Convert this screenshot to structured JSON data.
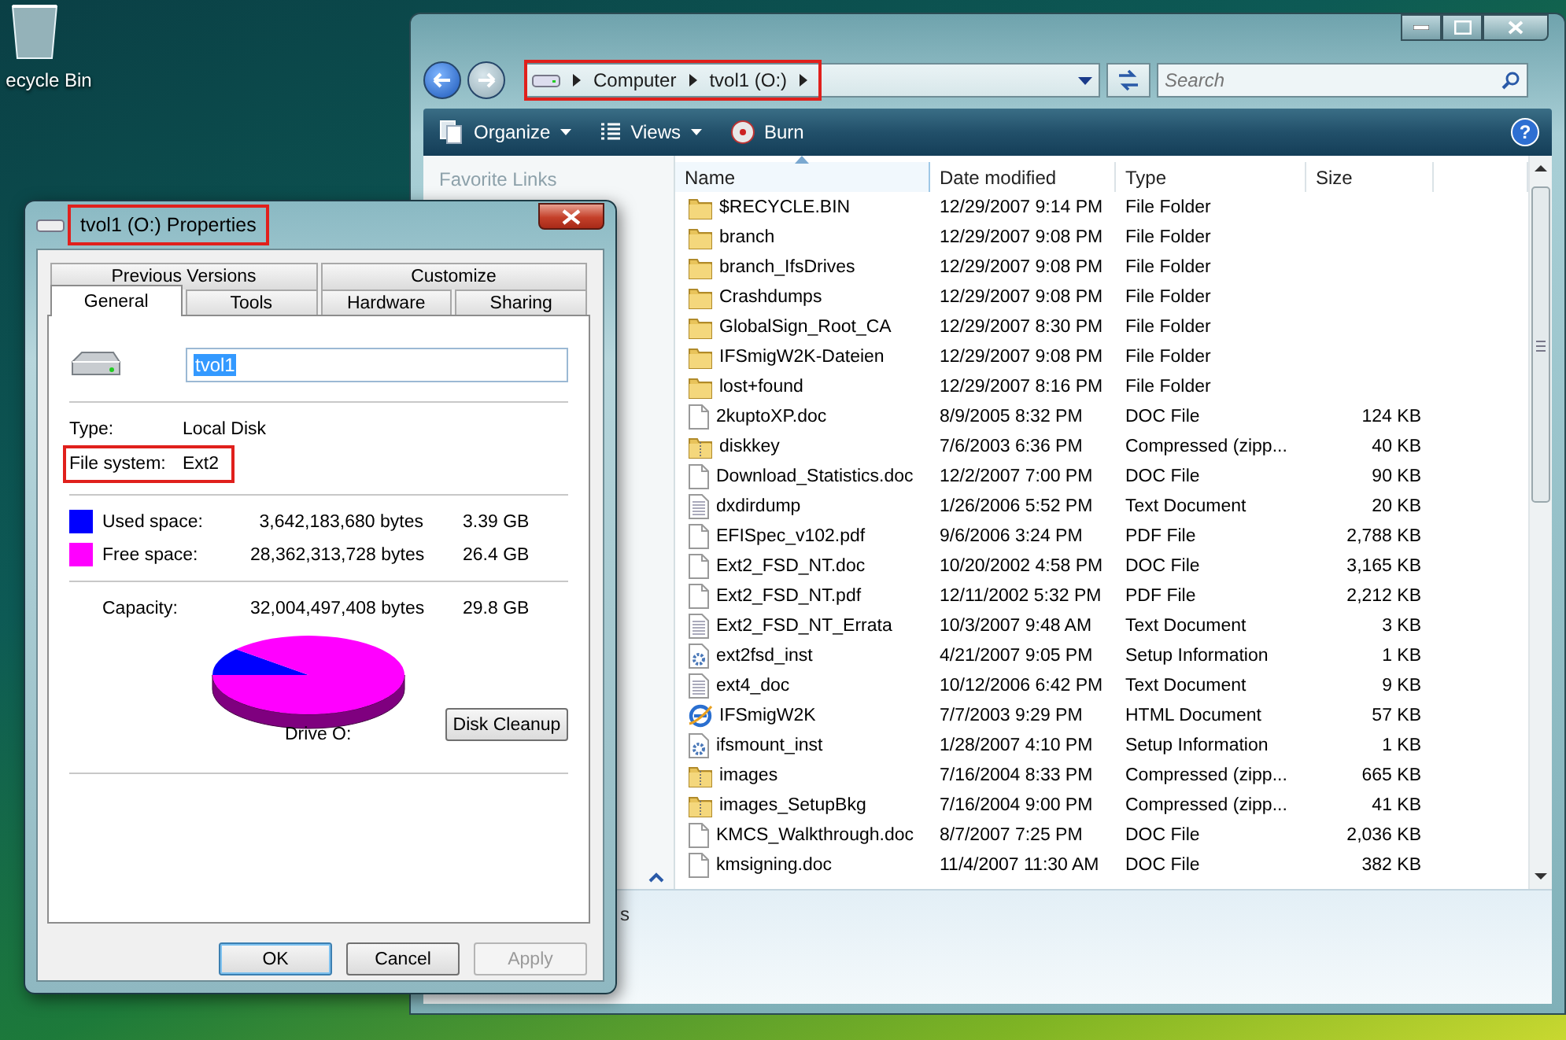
{
  "desktop": {
    "icons": [
      {
        "label": "ecycle Bin"
      }
    ]
  },
  "explorer": {
    "address": {
      "breadcrumbs": [
        "Computer",
        "tvol1 (O:)"
      ],
      "highlighted": true
    },
    "search": {
      "placeholder": "Search"
    },
    "help_button": "?",
    "toolbar": [
      {
        "label": "Organize",
        "kind": "organize",
        "dropdown": true
      },
      {
        "label": "Views",
        "kind": "views",
        "dropdown": true
      },
      {
        "label": "Burn",
        "kind": "burn",
        "dropdown": false
      }
    ],
    "nav_pane": {
      "heading": "Favorite Links",
      "folders_label": "s"
    },
    "columns": [
      {
        "label": "Name",
        "sorted": true
      },
      {
        "label": "Date modified",
        "sorted": false
      },
      {
        "label": "Type",
        "sorted": false
      },
      {
        "label": "Size",
        "sorted": false
      }
    ],
    "rows": [
      {
        "name": "$RECYCLE.BIN",
        "date": "12/29/2007 9:14 PM",
        "type": "File Folder",
        "kind": "folder"
      },
      {
        "name": "branch",
        "date": "12/29/2007 9:08 PM",
        "type": "File Folder",
        "kind": "folder"
      },
      {
        "name": "branch_IfsDrives",
        "date": "12/29/2007 9:08 PM",
        "type": "File Folder",
        "kind": "folder"
      },
      {
        "name": "Crashdumps",
        "date": "12/29/2007 9:08 PM",
        "type": "File Folder",
        "kind": "folder"
      },
      {
        "name": "GlobalSign_Root_CA",
        "date": "12/29/2007 8:30 PM",
        "type": "File Folder",
        "kind": "folder"
      },
      {
        "name": "IFSmigW2K-Dateien",
        "date": "12/29/2007 9:08 PM",
        "type": "File Folder",
        "kind": "folder"
      },
      {
        "name": "lost+found",
        "date": "12/29/2007 8:16 PM",
        "type": "File Folder",
        "kind": "folder"
      },
      {
        "name": "2kuptoXP.doc",
        "date": "8/9/2005 8:32 PM",
        "type": "DOC File",
        "size": "124 KB",
        "kind": "document"
      },
      {
        "name": "diskkey",
        "date": "7/6/2003 6:36 PM",
        "type": "Compressed (zipp...",
        "size": "40 KB",
        "kind": "zip"
      },
      {
        "name": "Download_Statistics.doc",
        "date": "12/2/2007 7:00 PM",
        "type": "DOC File",
        "size": "90 KB",
        "kind": "document"
      },
      {
        "name": "dxdirdump",
        "date": "1/26/2006 5:52 PM",
        "type": "Text Document",
        "size": "20 KB",
        "kind": "text"
      },
      {
        "name": "EFISpec_v102.pdf",
        "date": "9/6/2006 3:24 PM",
        "type": "PDF File",
        "size": "2,788 KB",
        "kind": "document"
      },
      {
        "name": "Ext2_FSD_NT.doc",
        "date": "10/20/2002 4:58 PM",
        "type": "DOC File",
        "size": "3,165 KB",
        "kind": "document"
      },
      {
        "name": "Ext2_FSD_NT.pdf",
        "date": "12/11/2002 5:32 PM",
        "type": "PDF File",
        "size": "2,212 KB",
        "kind": "document"
      },
      {
        "name": "Ext2_FSD_NT_Errata",
        "date": "10/3/2007 9:48 AM",
        "type": "Text Document",
        "size": "3 KB",
        "kind": "text"
      },
      {
        "name": "ext2fsd_inst",
        "date": "4/21/2007 9:05 PM",
        "type": "Setup Information",
        "size": "1 KB",
        "kind": "setup"
      },
      {
        "name": "ext4_doc",
        "date": "10/12/2006 6:42 PM",
        "type": "Text Document",
        "size": "9 KB",
        "kind": "text"
      },
      {
        "name": "IFSmigW2K",
        "date": "7/7/2003 9:29 PM",
        "type": "HTML Document",
        "size": "57 KB",
        "kind": "html"
      },
      {
        "name": "ifsmount_inst",
        "date": "1/28/2007 4:10 PM",
        "type": "Setup Information",
        "size": "1 KB",
        "kind": "setup"
      },
      {
        "name": "images",
        "date": "7/16/2004 8:33 PM",
        "type": "Compressed (zipp...",
        "size": "665 KB",
        "kind": "zip"
      },
      {
        "name": "images_SetupBkg",
        "date": "7/16/2004 9:00 PM",
        "type": "Compressed (zipp...",
        "size": "41 KB",
        "kind": "zip"
      },
      {
        "name": "KMCS_Walkthrough.doc",
        "date": "8/7/2007 7:25 PM",
        "type": "DOC File",
        "size": "2,036 KB",
        "kind": "document"
      },
      {
        "name": "kmsigning.doc",
        "date": "11/4/2007 11:30 AM",
        "type": "DOC File",
        "size": "382 KB",
        "kind": "document"
      }
    ]
  },
  "dialog": {
    "title": "tvol1 (O:) Properties",
    "highlighted": true,
    "tab_rows": [
      {
        "tabs": [
          {
            "label": "Previous Versions",
            "selected": false
          },
          {
            "label": "Customize",
            "selected": false
          }
        ]
      },
      {
        "tabs": [
          {
            "label": "General",
            "selected": true
          },
          {
            "label": "Tools",
            "selected": false
          },
          {
            "label": "Hardware",
            "selected": false
          },
          {
            "label": "Sharing",
            "selected": false
          }
        ]
      }
    ],
    "name_field": {
      "value": "tvol1",
      "text_selected": true
    },
    "info": [
      {
        "label": "Type:",
        "value": "Local Disk",
        "highlighted": false
      },
      {
        "label": "File system:",
        "value": "Ext2",
        "highlighted": true
      }
    ],
    "space": [
      {
        "label": "Used space:",
        "bytes": "3,642,183,680 bytes",
        "size": "3.39 GB",
        "color": "#0000ff"
      },
      {
        "label": "Free space:",
        "bytes": "28,362,313,728 bytes",
        "size": "26.4 GB",
        "color": "#ff00ff"
      }
    ],
    "capacity": {
      "label": "Capacity:",
      "bytes": "32,004,497,408 bytes",
      "size": "29.8 GB"
    },
    "drive_label": "Drive O:",
    "cleanup_button": "Disk Cleanup",
    "buttons": [
      {
        "label": "OK",
        "default": true,
        "disabled": false
      },
      {
        "label": "Cancel",
        "default": false,
        "disabled": false
      },
      {
        "label": "Apply",
        "default": false,
        "disabled": true
      }
    ]
  }
}
